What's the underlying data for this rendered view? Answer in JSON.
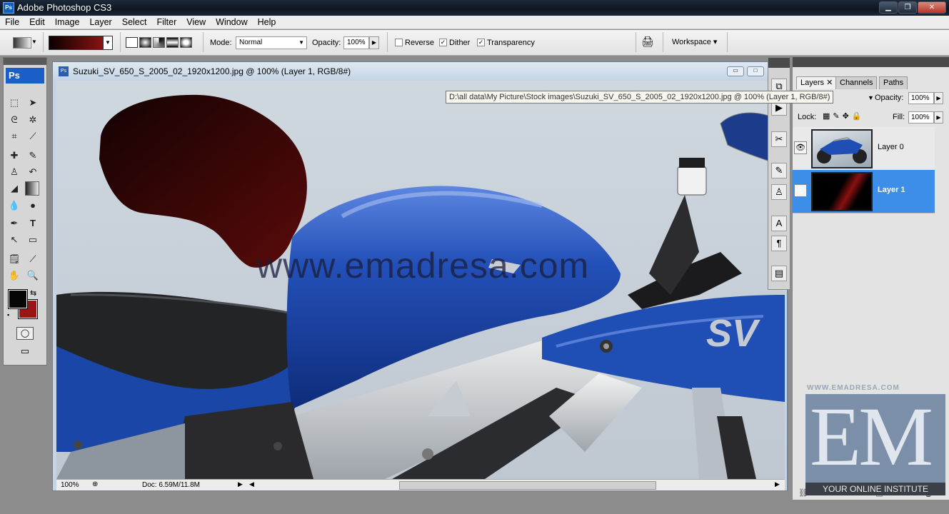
{
  "app": {
    "title": "Adobe Photoshop CS3",
    "icon_text": "Ps"
  },
  "window_buttons": {
    "minimize": "▁",
    "restore": "❐",
    "close": "✕"
  },
  "menu": [
    "File",
    "Edit",
    "Image",
    "Layer",
    "Select",
    "Filter",
    "View",
    "Window",
    "Help"
  ],
  "options": {
    "gradient_colors": [
      "#0c0000",
      "#9e1616"
    ],
    "mode_label": "Mode:",
    "mode_value": "Normal",
    "opacity_label": "Opacity:",
    "opacity_value": "100%",
    "reverse_label": "Reverse",
    "reverse_checked": false,
    "dither_label": "Dither",
    "dither_checked": true,
    "transparency_label": "Transparency",
    "transparency_checked": true,
    "workspace_label": "Workspace ▾"
  },
  "toolbox": {
    "header": "Ps"
  },
  "document": {
    "title": "Suzuki_SV_650_S_2005_02_1920x1200.jpg @ 100% (Layer 1, RGB/8#)",
    "tooltip": "D:\\all data\\My Picture\\Stock images\\Suzuki_SV_650_S_2005_02_1920x1200.jpg @ 100% (Layer 1, RGB/8#)",
    "zoom": "100%",
    "doc_size": "Doc: 6.59M/11.8M",
    "watermark_text": "www.emadresa.com",
    "bike_color": "#1f4fb5"
  },
  "layers_panel": {
    "tabs": [
      "Layers",
      "Channels",
      "Paths"
    ],
    "opacity_label": "Opacity:",
    "opacity_value": "100%",
    "lock_label": "Lock:",
    "fill_label": "Fill:",
    "fill_value": "100%",
    "layers": [
      {
        "name": "Layer 0",
        "selected": false
      },
      {
        "name": "Layer 1",
        "selected": true
      }
    ],
    "accent_color": "#3d8ee8"
  },
  "overlay_logo": {
    "top_text": "WWW.EMADRESA.COM",
    "letters": "EM",
    "tagline": "YOUR ONLINE INSTITUTE"
  }
}
